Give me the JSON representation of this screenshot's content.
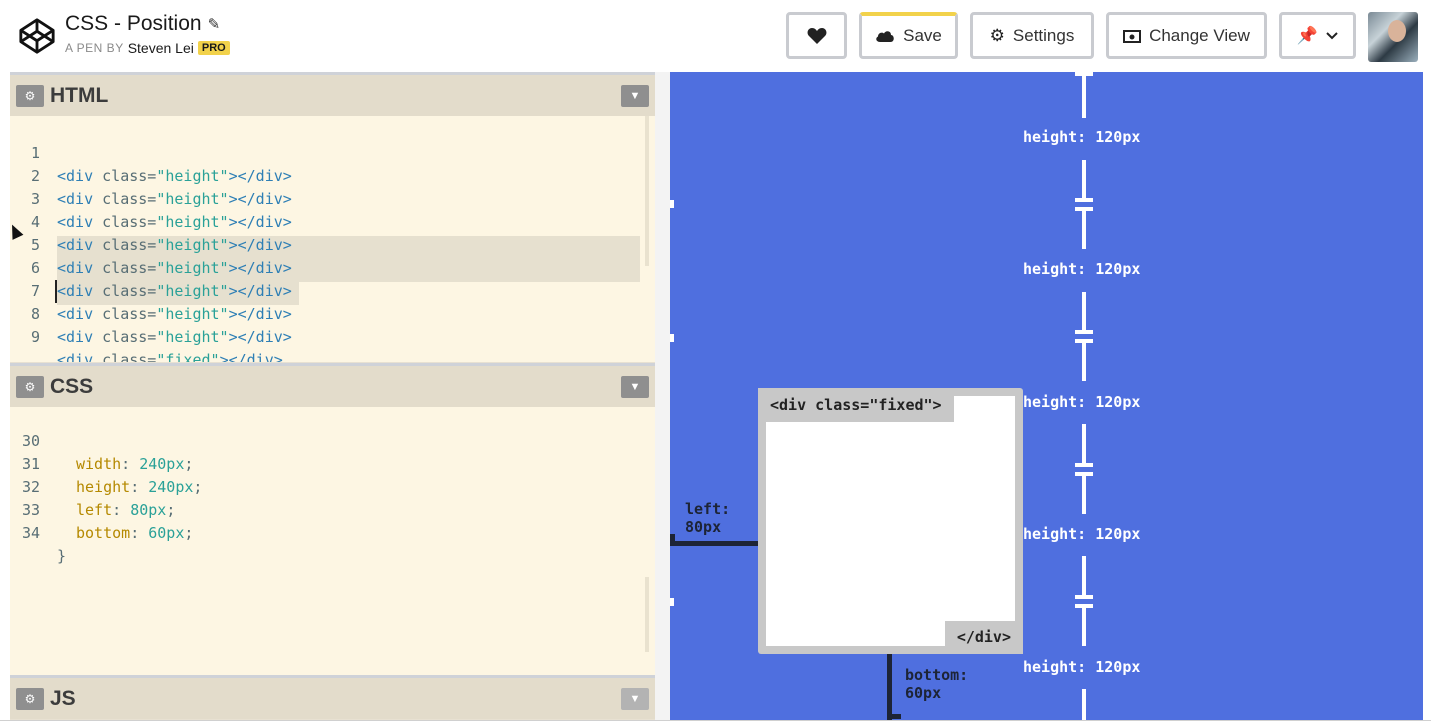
{
  "header": {
    "title": "CSS - Position",
    "by_prefix": "A PEN BY",
    "author": "Steven Lei",
    "badge": "PRO",
    "caption_left": "~~~",
    "caption_right": "~~~",
    "buttons": {
      "heart": {
        "icon": "heart-icon"
      },
      "save": {
        "icon": "cloud-icon",
        "label": "Save"
      },
      "settings": {
        "icon": "gear-icon",
        "label": "Settings"
      },
      "change_view": {
        "icon": "eye-icon",
        "label": "Change View"
      },
      "pin": {
        "icon": "pin-icon"
      }
    },
    "accent": "#f2d24b"
  },
  "html_pane": {
    "title": "HTML",
    "lines": [
      {
        "n": "1",
        "tag_open": "<div",
        "attr": " class=",
        "value": "\"height\"",
        "tag_close": "></div>"
      },
      {
        "n": "2",
        "tag_open": "<div",
        "attr": " class=",
        "value": "\"height\"",
        "tag_close": "></div>"
      },
      {
        "n": "3",
        "tag_open": "<div",
        "attr": " class=",
        "value": "\"height\"",
        "tag_close": "></div>"
      },
      {
        "n": "4",
        "tag_open": "<div",
        "attr": " class=",
        "value": "\"height\"",
        "tag_close": "></div>"
      },
      {
        "n": "5",
        "tag_open": "<div",
        "attr": " class=",
        "value": "\"height\"",
        "tag_close": "></div>"
      },
      {
        "n": "6",
        "tag_open": "<div",
        "attr": " class=",
        "value": "\"height\"",
        "tag_close": "></div>"
      },
      {
        "n": "7",
        "tag_open": "<div",
        "attr": " class=",
        "value": "\"height\"",
        "tag_close": "></div>"
      },
      {
        "n": "8",
        "tag_open": "<div",
        "attr": " class=",
        "value": "\"height\"",
        "tag_close": "></div>"
      },
      {
        "n": "9",
        "tag_open": "<div",
        "attr": " class=",
        "value": "\"fixed\"",
        "tag_close": "></div>"
      }
    ]
  },
  "css_pane": {
    "title": "CSS",
    "lines": [
      {
        "n": "30",
        "prop": "width",
        "value": "240px"
      },
      {
        "n": "31",
        "prop": "height",
        "value": "240px"
      },
      {
        "n": "32",
        "prop": "left",
        "value": "80px"
      },
      {
        "n": "33",
        "prop": "bottom",
        "value": "60px"
      },
      {
        "n": "34",
        "close": "}"
      }
    ]
  },
  "js_pane": {
    "title": "JS"
  },
  "preview": {
    "height_labels": [
      "height: 120px",
      "height: 120px",
      "height: 120px",
      "height: 120px",
      "height: 120px"
    ],
    "fixed_open": "<div class=\"fixed\">",
    "fixed_close": "</div>",
    "left_label": "left:\n80px",
    "bottom_label": "bottom:\n60px",
    "background": "#4f6fdf"
  }
}
